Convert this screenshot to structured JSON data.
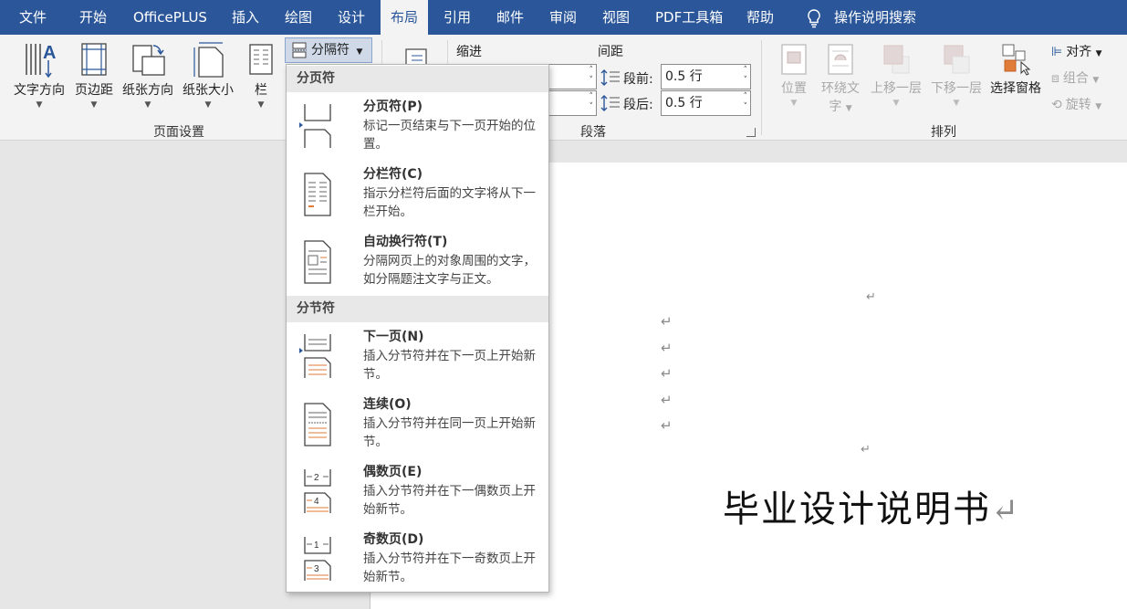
{
  "tabs": [
    {
      "label": "文件"
    },
    {
      "label": "开始"
    },
    {
      "label": "OfficePLUS"
    },
    {
      "label": "插入"
    },
    {
      "label": "绘图"
    },
    {
      "label": "设计"
    },
    {
      "label": "布局"
    },
    {
      "label": "引用"
    },
    {
      "label": "邮件"
    },
    {
      "label": "审阅"
    },
    {
      "label": "视图"
    },
    {
      "label": "PDF工具箱"
    },
    {
      "label": "帮助"
    }
  ],
  "active_tab": "布局",
  "search_label": "操作说明搜索",
  "ribbon": {
    "page_setup": {
      "group_label": "页面设置",
      "text_direction": "文字方向",
      "margins": "页边距",
      "orientation": "纸张方向",
      "size": "纸张大小",
      "columns": "栏",
      "breaks": "分隔符"
    },
    "paragraph": {
      "group_label": "段落",
      "indent_label": "缩进",
      "spacing_label": "间距",
      "before_label": "段前:",
      "before_value": "0.5 行",
      "after_label": "段后:",
      "after_value": "0.5 行"
    },
    "arrange": {
      "group_label": "排列",
      "position": "位置",
      "wrap_text_1": "环绕文",
      "wrap_text_2": "字",
      "bring_forward": "上移一层",
      "send_backward": "下移一层",
      "selection_pane": "选择窗格",
      "align": "对齐",
      "group": "组合",
      "rotate": "旋转"
    }
  },
  "menu": {
    "page_breaks_header": "分页符",
    "section_breaks_header": "分节符",
    "items": [
      {
        "title": "分页符(P)",
        "desc": "标记一页结束与下一页开始的位置。"
      },
      {
        "title": "分栏符(C)",
        "desc": "指示分栏符后面的文字将从下一栏开始。"
      },
      {
        "title": "自动换行符(T)",
        "desc": "分隔网页上的对象周围的文字，如分隔题注文字与正文。"
      },
      {
        "title": "下一页(N)",
        "desc": "插入分节符并在下一页上开始新节。"
      },
      {
        "title": "连续(O)",
        "desc": "插入分节符并在同一页上开始新节。"
      },
      {
        "title": "偶数页(E)",
        "desc": "插入分节符并在下一偶数页上开始新节。"
      },
      {
        "title": "奇数页(D)",
        "desc": "插入分节符并在下一奇数页上开始新节。"
      }
    ]
  },
  "document": {
    "paragraph_mark": "↵",
    "title": "毕业设计说明书"
  },
  "colors": {
    "tab_bar": "#2b579a",
    "ribbon_bg": "#f3f3f3",
    "accent_orange": "#e07b39"
  }
}
